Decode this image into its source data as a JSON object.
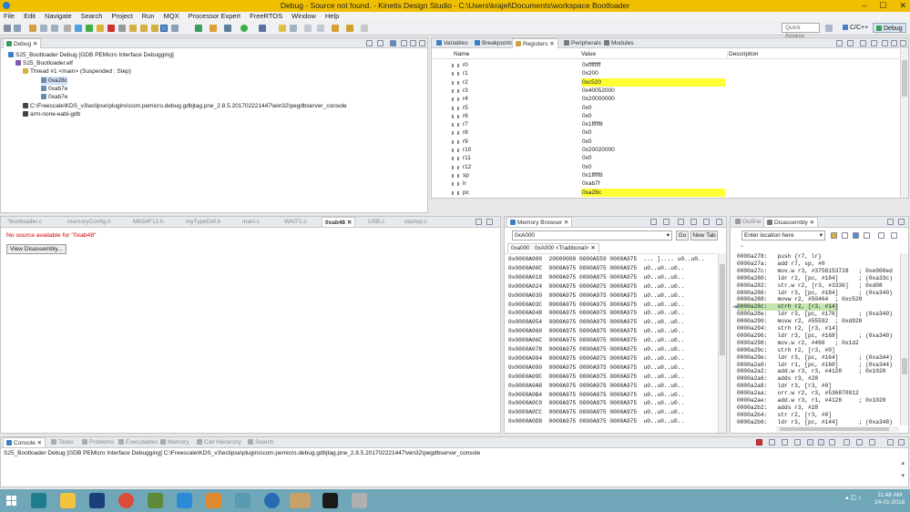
{
  "window": {
    "title": "Debug - Source not found. - Kinetis Design Studio - C:\\Users\\krajel\\Documents\\workspace Bootloader",
    "min": "–",
    "max": "☐",
    "close": "✕"
  },
  "menu": [
    "File",
    "Edit",
    "Navigate",
    "Search",
    "Project",
    "Run",
    "MQX",
    "Processor Expert",
    "FreeRTOS",
    "Window",
    "Help"
  ],
  "toolbar": {
    "quick_access": "Quick Access",
    "perspective_cc": "C/C++",
    "perspective_debug": "Debug"
  },
  "debug_view": {
    "tab": "Debug",
    "tree": [
      "S25_Bootloader Debug [GDB PEMicro Interface Debugging]",
      "S25_Bootloader.elf",
      "Thread #1 <main> (Suspended : Step)",
      "0xa28c",
      "0xab7e",
      "0xab7e",
      "C:\\Freescale\\KDS_v3\\eclipse\\plugins\\com.pemicro.debug.gdbjtag.pne_2.8.5.201702221447\\win32\\pegdbserver_console",
      "arm-none-eabi-gdb"
    ]
  },
  "registers_view": {
    "tabs": [
      "Variables",
      "Breakpoints",
      "Registers",
      "Peripherals",
      "Modules"
    ],
    "columns": [
      "Name",
      "Value",
      "Description"
    ],
    "rows": [
      {
        "name": "r0",
        "value": "0xffffffff",
        "hl": false
      },
      {
        "name": "r1",
        "value": "0x200",
        "hl": false
      },
      {
        "name": "r2",
        "value": "0xc520",
        "hl": true
      },
      {
        "name": "r3",
        "value": "0x40052000",
        "hl": false
      },
      {
        "name": "r4",
        "value": "0x20000000",
        "hl": false
      },
      {
        "name": "r5",
        "value": "0x0",
        "hl": false
      },
      {
        "name": "r6",
        "value": "0x0",
        "hl": false
      },
      {
        "name": "r7",
        "value": "0x1fffff8",
        "hl": false
      },
      {
        "name": "r8",
        "value": "0x0",
        "hl": false
      },
      {
        "name": "r9",
        "value": "0x0",
        "hl": false
      },
      {
        "name": "r10",
        "value": "0x20020000",
        "hl": false
      },
      {
        "name": "r11",
        "value": "0x0",
        "hl": false
      },
      {
        "name": "r12",
        "value": "0x0",
        "hl": false
      },
      {
        "name": "sp",
        "value": "0x1fffff8",
        "hl": false
      },
      {
        "name": "lr",
        "value": "0xab7f",
        "hl": false
      },
      {
        "name": "pc",
        "value": "0xa28c",
        "hl": true
      }
    ]
  },
  "editor": {
    "tabs": [
      "*bootloader.c",
      "memoryConfig.h",
      "MK64F12.h",
      "myTypeDef.h",
      "main.c",
      "WAIT1.c",
      "0xab48",
      "USB.c",
      "startup.c"
    ],
    "message": "No source available for \"0xab48\"",
    "button": "View Disassembly..."
  },
  "memory_view": {
    "tab": "Memory Browser",
    "address": "0xA000",
    "go": "Go",
    "new_tab": "New Tab",
    "subtab": "0xa000 : 0xA000 <Traditional>",
    "rows": [
      "0x0000A000  20000000 0000A559 0000A975  ... ].... u0..u0..",
      "0x0000A00C  0000A975 0000A975 0000A975  u0..u0..u0..",
      "0x0000A018  0000A975 0000A975 0000A975  u0..u0..u0..",
      "0x0000A024  0000A975 0000A975 0000A975  u0..u0..u0..",
      "0x0000A030  0000A975 0000A975 0000A975  u0..u0..u0..",
      "0x0000A03C  0000A975 0000A975 0000A975  u0..u0..u0..",
      "0x0000A048  0000A975 0000A975 0000A975  u0..u0..u0..",
      "0x0000A054  0000A975 0000A975 0000A975  u0..u0..u0..",
      "0x0000A060  0000A975 0000A975 0000A975  u0..u0..u0..",
      "0x0000A06C  0000A975 0000A975 0000A975  u0..u0..u0..",
      "0x0000A078  0000A975 0000A975 0000A975  u0..u0..u0..",
      "0x0000A084  0000A975 0000A975 0000A975  u0..u0..u0..",
      "0x0000A090  0000A975 0000A975 0000A975  u0..u0..u0..",
      "0x0000A09C  0000A975 0000A975 0000A975  u0..u0..u0..",
      "0x0000A0A8  0000A975 0000A975 0000A975  u0..u0..u0..",
      "0x0000A0B4  0000A975 0000A975 0000A975  u0..u0..u0..",
      "0x0000A0C0  0000A975 0000A975 0000A975  u0..u0..u0..",
      "0x0000A0CC  0000A975 0000A975 0000A975  u0..u0..u0..",
      "0x0000A0D8  0000A975 0000A975 0000A975  u0..u0..u0.."
    ]
  },
  "disassembly_view": {
    "tabs": [
      "Outline",
      "Disassembly"
    ],
    "location_placeholder": "Enter location here",
    "current_index": 8,
    "rows": [
      "0000a278:   push {r7, lr}",
      "0000a27a:   add r7, sp, #0",
      "0000a27c:   mov.w r3, #3758153728   ; 0xe000ed",
      "0000a280:   ldr r2, [pc, #184]      ; (0xa33c)",
      "0000a282:   str.w r2, [r3, #3336]   ; 0xd08",
      "0000a286:   ldr r3, [pc, #184]      ; (0xa340)",
      "0000a288:   movw r2, #50464  ; 0xc520",
      "0000a28c:   strh r2, [r3, #14]",
      "0000a28e:   ldr r3, [pc, #176]      ; (0xa340)",
      "0000a290:   movw r2, #55592  ; 0xd928",
      "0000a294:   strh r2, [r3, #14]",
      "0000a296:   ldr r3, [pc, #168]      ; (0xa340)",
      "0000a298:   mov.w r2, #466   ; 0x1d2",
      "0000a29c:   strh r2, [r3, #0]",
      "0000a29e:   ldr r3, [pc, #164]      ; (0xa344)",
      "0000a2a0:   ldr r1, [pc, #160]      ; (0xa344)",
      "0000a2a2:   add.w r3, r3, #4128     ; 0x1020",
      "0000a2a6:   adds r3, #28",
      "0000a2a8:   ldr r3, [r3, #0]",
      "0000a2aa:   orr.w r2, r3, #536870912",
      "0000a2ae:   add.w r3, r1, #4128     ; 0x1020",
      "0000a2b2:   adds r3, #28",
      "0000a2b4:   str r2, [r3, #0]",
      "0000a2b6:   ldr r3, [pc, #144]      ; (0xa348)"
    ]
  },
  "console": {
    "tabs": [
      "Console",
      "Tasks",
      "Problems",
      "Executables",
      "Memory",
      "Call Hierarchy",
      "Search"
    ],
    "line": "S25_Bootloader Debug [GDB PEMicro Interface Debugging] C:\\Freescale\\KDS_v3\\eclipse\\plugins\\com.pemicro.debug.gdbjtag.pne_2.8.5.201702221447\\win32\\pegdbserver_console"
  },
  "taskbar": {
    "time": "11:48 AM",
    "date": "24-01-2018"
  },
  "colors": {
    "title_bar": "#f0c000",
    "highlight": "#ffff33",
    "current_line": "#c6e6b0",
    "error_text": "#cc0000",
    "taskbar": "#6fa7b8"
  }
}
